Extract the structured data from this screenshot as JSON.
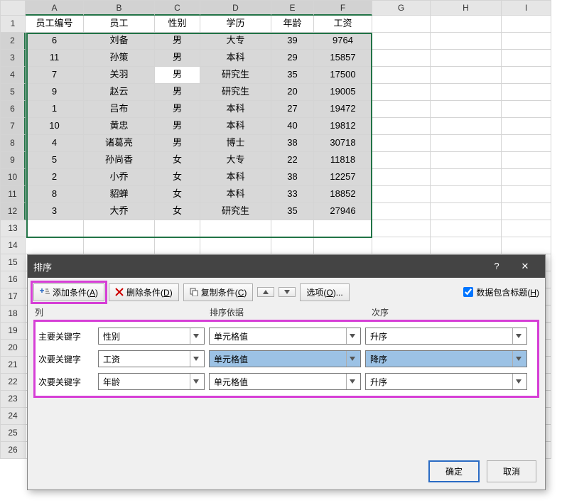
{
  "columns": [
    "A",
    "B",
    "C",
    "D",
    "E",
    "F",
    "G",
    "H",
    "I"
  ],
  "headers": [
    "员工编号",
    "员工",
    "性别",
    "学历",
    "年龄",
    "工资"
  ],
  "rows": [
    {
      "r": 2,
      "c": [
        "6",
        "刘备",
        "男",
        "大专",
        "39",
        "9764"
      ]
    },
    {
      "r": 3,
      "c": [
        "11",
        "孙策",
        "男",
        "本科",
        "29",
        "15857"
      ]
    },
    {
      "r": 4,
      "c": [
        "7",
        "关羽",
        "男",
        "研究生",
        "35",
        "17500"
      ]
    },
    {
      "r": 5,
      "c": [
        "9",
        "赵云",
        "男",
        "研究生",
        "20",
        "19005"
      ]
    },
    {
      "r": 6,
      "c": [
        "1",
        "吕布",
        "男",
        "本科",
        "27",
        "19472"
      ]
    },
    {
      "r": 7,
      "c": [
        "10",
        "黄忠",
        "男",
        "本科",
        "40",
        "19812"
      ]
    },
    {
      "r": 8,
      "c": [
        "4",
        "诸葛亮",
        "男",
        "博士",
        "38",
        "30718"
      ]
    },
    {
      "r": 9,
      "c": [
        "5",
        "孙尚香",
        "女",
        "大专",
        "22",
        "11818"
      ]
    },
    {
      "r": 10,
      "c": [
        "2",
        "小乔",
        "女",
        "本科",
        "38",
        "12257"
      ]
    },
    {
      "r": 11,
      "c": [
        "8",
        "貂蝉",
        "女",
        "本科",
        "33",
        "18852"
      ]
    },
    {
      "r": 12,
      "c": [
        "3",
        "大乔",
        "女",
        "研究生",
        "35",
        "27946"
      ]
    }
  ],
  "active_cell": {
    "row": 4,
    "col": "C"
  },
  "dialog": {
    "title": "排序",
    "help": "?",
    "close": "✕",
    "add_prefix": "添加条件(",
    "add_u": "A",
    "add_suffix": ")",
    "delete_prefix": "删除条件(",
    "delete_u": "D",
    "delete_suffix": ")",
    "copy_prefix": "复制条件(",
    "copy_u": "C",
    "copy_suffix": ")",
    "options_prefix": "选项(",
    "options_u": "O",
    "options_suffix": ")...",
    "header_chk_prefix": "数据包含标题(",
    "header_chk_u": "H",
    "header_chk_suffix": ")",
    "col_label": "列",
    "basis_label": "排序依据",
    "order_label": "次序",
    "levels": [
      {
        "label": "主要关键字",
        "field": "性别",
        "basis": "单元格值",
        "order": "升序",
        "hl": false
      },
      {
        "label": "次要关键字",
        "field": "工资",
        "basis": "单元格值",
        "order": "降序",
        "hl": true
      },
      {
        "label": "次要关键字",
        "field": "年龄",
        "basis": "单元格值",
        "order": "升序",
        "hl": false
      }
    ],
    "ok": "确定",
    "cancel": "取消"
  }
}
